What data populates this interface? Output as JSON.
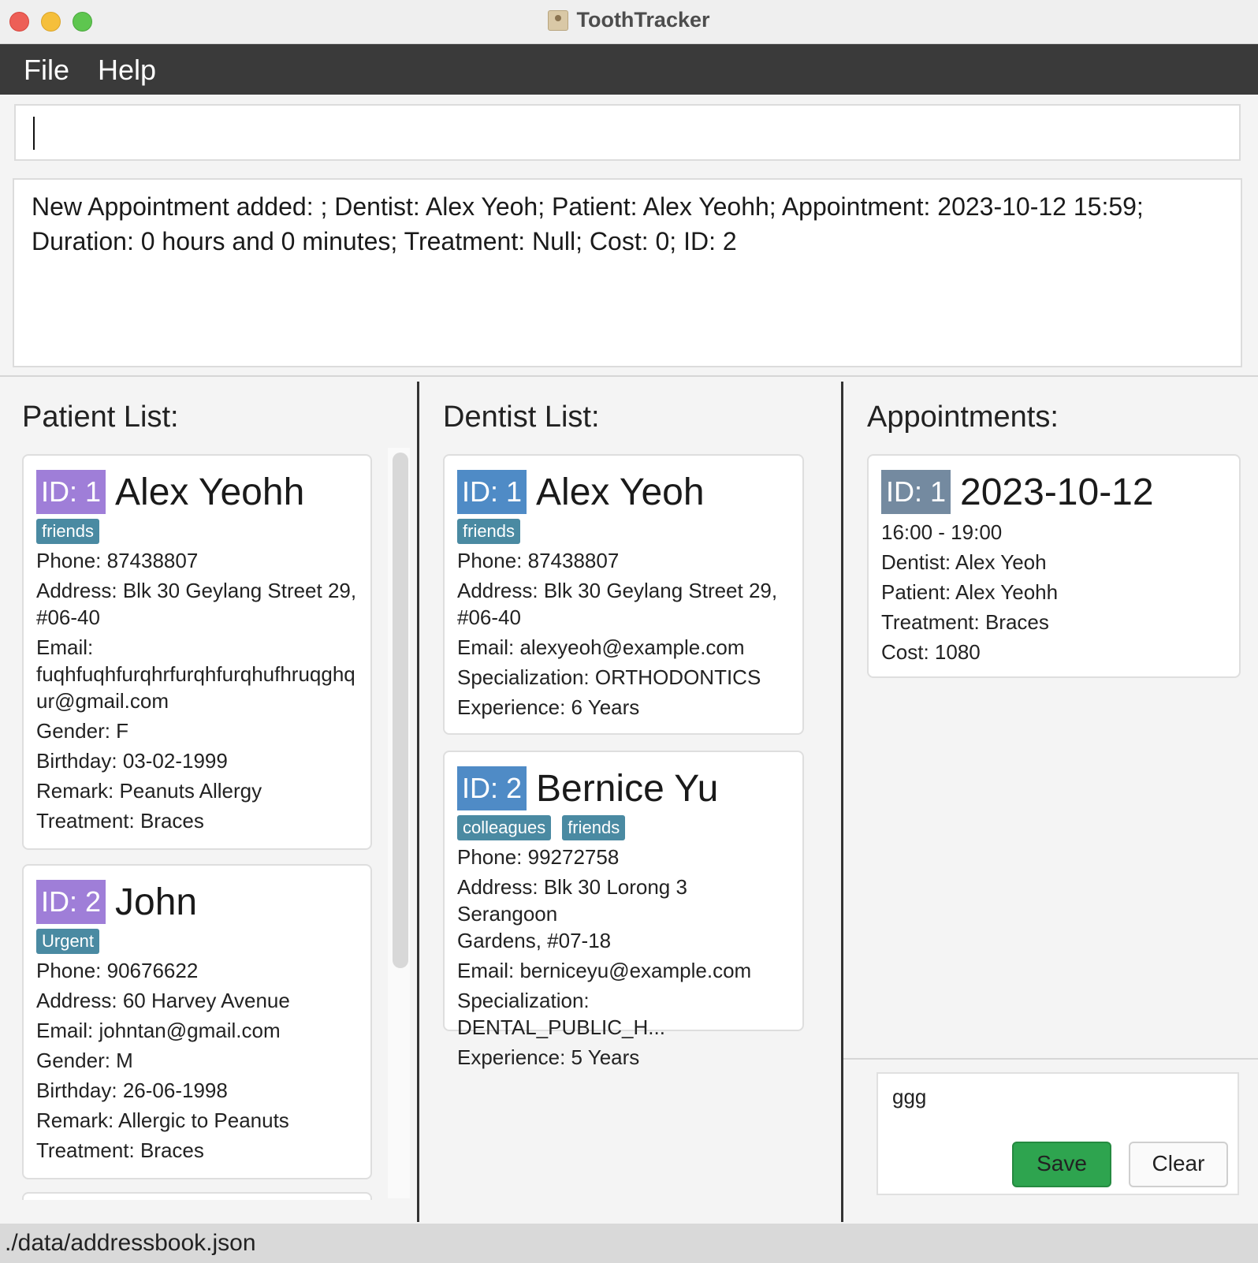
{
  "window": {
    "title": "ToothTracker"
  },
  "menu": {
    "file": "File",
    "help": "Help"
  },
  "command": {
    "value": "",
    "placeholder": ""
  },
  "result": {
    "line1": "New Appointment added: ; Dentist: Alex Yeoh; Patient: Alex Yeohh; Appointment: 2023-10-12 15:59;",
    "line2": "Duration: 0 hours and 0 minutes; Treatment: Null; Cost: 0; ID: 2"
  },
  "patients": {
    "title": "Patient List:",
    "items": [
      {
        "id": "ID: 1",
        "name": "Alex Yeohh",
        "tags": [
          "friends"
        ],
        "phone": "Phone: 87438807",
        "address1": "Address: Blk 30 Geylang Street 29,",
        "address2": "#06-40",
        "email1": "Email:",
        "email2": "fuqhfuqhfurqhrfurqhfurqhufhruqghq",
        "email3": "ur@gmail.com",
        "gender": "Gender: F",
        "birthday": "Birthday: 03-02-1999",
        "remark": "Remark: Peanuts Allergy",
        "treatment": "Treatment: Braces"
      },
      {
        "id": "ID: 2",
        "name": "John",
        "tags": [
          "Urgent"
        ],
        "phone": "Phone: 90676622",
        "address1": "Address: 60 Harvey Avenue",
        "email1": "Email: johntan@gmail.com",
        "gender": "Gender: M",
        "birthday": "Birthday: 26-06-1998",
        "remark": "Remark: Allergic to Peanuts",
        "treatment": "Treatment: Braces"
      }
    ]
  },
  "dentists": {
    "title": "Dentist List:",
    "items": [
      {
        "id": "ID: 1",
        "name": "Alex Yeoh",
        "tags": [
          "friends"
        ],
        "phone": "Phone: 87438807",
        "address1": "Address: Blk 30 Geylang Street 29,",
        "address2": "#06-40",
        "email": "Email: alexyeoh@example.com",
        "specialization": "Specialization: ORTHODONTICS",
        "experience": "Experience: 6 Years"
      },
      {
        "id": "ID: 2",
        "name": "Bernice Yu",
        "tags": [
          "colleagues",
          "friends"
        ],
        "phone": "Phone: 99272758",
        "address1": "Address: Blk 30 Lorong 3 Serangoon",
        "address2": "Gardens, #07-18",
        "email": "Email: berniceyu@example.com",
        "specialization": "Specialization: DENTAL_PUBLIC_H...",
        "experience": "Experience: 5 Years"
      }
    ]
  },
  "appointments": {
    "title": "Appointments:",
    "items": [
      {
        "id": "ID: 1",
        "date": "2023-10-12",
        "time": "16:00 - 19:00",
        "dentist": "Dentist: Alex Yeoh",
        "patient": "Patient: Alex Yeohh",
        "treatment": "Treatment: Braces",
        "cost": "Cost: 1080"
      }
    ]
  },
  "remark_editor": {
    "text": "ggg",
    "save": "Save",
    "clear": "Clear"
  },
  "status": {
    "path": "./data/addressbook.json"
  },
  "colors": {
    "menubar": "#3a3a3a",
    "patient_id": "#9f7ed8",
    "dentist_id": "#4f8bc6",
    "appointment_id": "#748aa0",
    "tag": "#4a8aa2",
    "save_button": "#2ea44f"
  }
}
